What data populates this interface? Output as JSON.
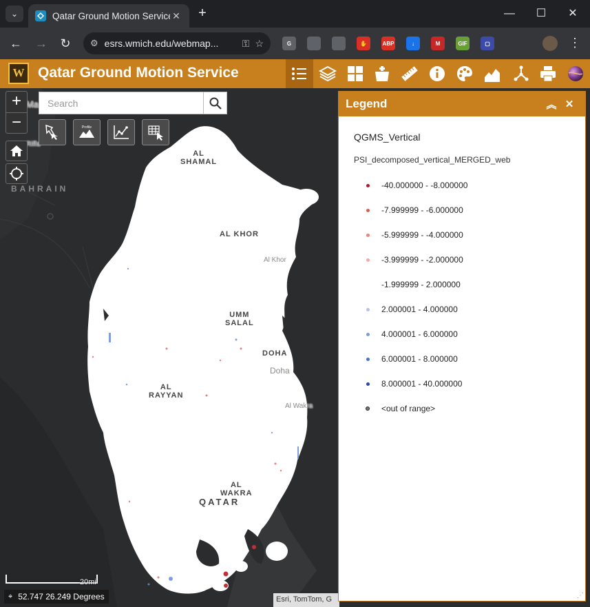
{
  "browser": {
    "tab_title": "Qatar Ground Motion Service",
    "tab_close": "✕",
    "new_tab": "+",
    "url": "esrs.wmich.edu/webmap...",
    "window_minimize": "—",
    "window_maximize": "☐",
    "window_close": "✕",
    "extensions": [
      {
        "name": "grammarly",
        "label": "G",
        "color": "#5f6368"
      },
      {
        "name": "extension-a",
        "label": "",
        "color": "#5f6368"
      },
      {
        "name": "extension-b",
        "label": "",
        "color": "#5f6368"
      },
      {
        "name": "stop",
        "label": "✋",
        "color": "#d93025"
      },
      {
        "name": "adblock-plus",
        "label": "ABP",
        "color": "#d93025"
      },
      {
        "name": "download",
        "label": "↓",
        "color": "#1a73e8"
      },
      {
        "name": "mendeley",
        "label": "M",
        "color": "#c62828"
      },
      {
        "name": "gif",
        "label": "GIF",
        "color": "#689f38"
      },
      {
        "name": "screen",
        "label": "▢",
        "color": "#3c4ba8"
      },
      {
        "name": "extensions-puzzle",
        "label": "",
        "color": "#35363a"
      }
    ]
  },
  "app": {
    "title": "Qatar Ground Motion Service",
    "logo_text": "W",
    "header_tools": [
      "legend",
      "layers",
      "basemap-gallery",
      "add-data",
      "measure",
      "about",
      "color-palette",
      "elevation-profile",
      "share",
      "print",
      "globe"
    ]
  },
  "map": {
    "search_placeholder": "Search",
    "zoom_in": "+",
    "zoom_out": "−",
    "widget_tools": [
      "select-tool",
      "profile-tool",
      "chart-tool",
      "grid-select-tool"
    ],
    "profile_label": "Profile",
    "labels": [
      {
        "name": "label-al-shamal",
        "text": "AL\nSHAMAL"
      },
      {
        "name": "label-al-khor",
        "text": "AL KHOR"
      },
      {
        "name": "label-al-khor-city",
        "text": "Al Khor"
      },
      {
        "name": "label-umm-salal",
        "text": "UMM\nSALAL"
      },
      {
        "name": "label-doha",
        "text": "DOHA"
      },
      {
        "name": "label-doha-city",
        "text": "Doha"
      },
      {
        "name": "label-al-rayyan",
        "text": "AL\nRAYYAN"
      },
      {
        "name": "label-al-wakra-city",
        "text": "Al Wakra"
      },
      {
        "name": "label-al-wakra",
        "text": "AL\nWAKRA"
      },
      {
        "name": "label-qatar",
        "text": "QATAR"
      }
    ],
    "bahrain_label": "BAHRAIN",
    "manama_label": "Ma",
    "riffa_label": "Riffa",
    "scale_label": "20mi",
    "coordinates": "52.747 26.249 Degrees",
    "attribution": "Esri, TomTom, G"
  },
  "legend": {
    "title": "Legend",
    "layer_name": "QGMS_Vertical",
    "sublayer_name": "PSI_decomposed_vertical_MERGED_web",
    "items": [
      {
        "label": "-40.000000 - -8.000000",
        "color": "#b2182b"
      },
      {
        "label": "-7.999999 - -6.000000",
        "color": "#d6604d"
      },
      {
        "label": "-5.999999 - -4.000000",
        "color": "#e8837a"
      },
      {
        "label": "-3.999999 - -2.000000",
        "color": "#f4a9a8"
      },
      {
        "label": "-1.999999 - 2.000000",
        "color": "#ffffff"
      },
      {
        "label": "2.000001 - 4.000000",
        "color": "#b4c3ea"
      },
      {
        "label": "4.000001 - 6.000000",
        "color": "#7b9bd8"
      },
      {
        "label": "6.000001 - 8.000000",
        "color": "#4a6fcc"
      },
      {
        "label": "8.000001 - 40.000000",
        "color": "#2a45b0"
      },
      {
        "label": "<out of range>",
        "color": "#777777"
      }
    ]
  }
}
